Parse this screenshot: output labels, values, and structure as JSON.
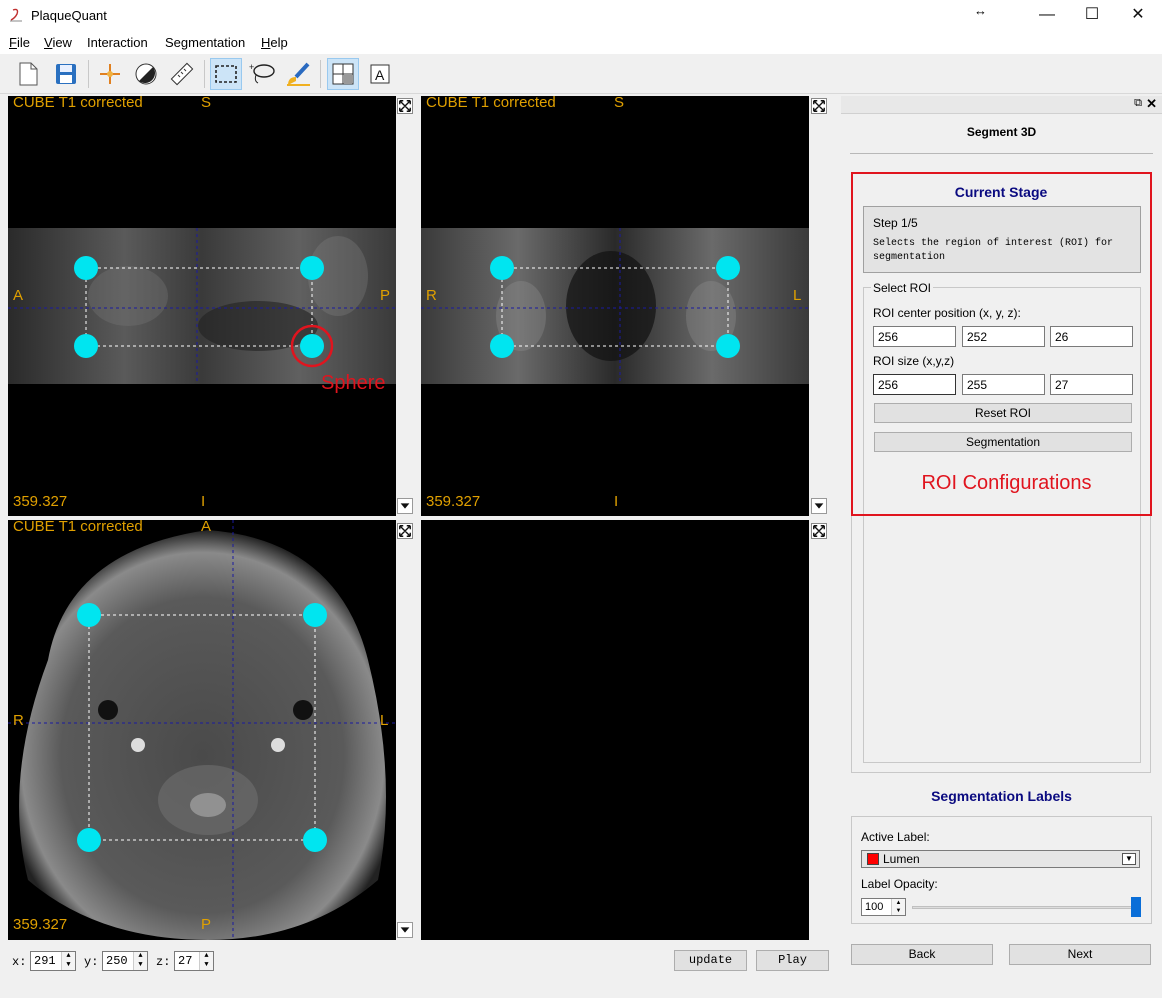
{
  "window": {
    "title": "PlaqueQuant",
    "controls": [
      "↔",
      "—",
      "☐",
      "✕"
    ]
  },
  "menu": [
    {
      "label": "File",
      "mnemonic": "F",
      "rest": "ile"
    },
    {
      "label": "View",
      "mnemonic": "V",
      "rest": "iew"
    },
    {
      "label": "Interaction",
      "mnemonic": "",
      "rest": "Interaction"
    },
    {
      "label": "Segmentation",
      "mnemonic": "",
      "rest": "Segmentation"
    },
    {
      "label": "Help",
      "mnemonic": "H",
      "rest": "elp"
    }
  ],
  "toolbar": {
    "icons": [
      "new-file-icon",
      "save-icon",
      "navigation-icon",
      "contrast-icon",
      "ruler-icon",
      "roi-rectangle-icon",
      "contour-icon",
      "brush-icon",
      "layout-icon",
      "annotation-icon"
    ],
    "active": [
      "roi-rectangle-icon",
      "layout-icon"
    ]
  },
  "viewports": {
    "sagittal": {
      "name": "CUBE T1 corrected",
      "top": "S",
      "bottom": "I",
      "left": "A",
      "right": "P",
      "value": "359.327"
    },
    "coronal": {
      "name": "CUBE T1 corrected",
      "top": "S",
      "bottom": "I",
      "left": "R",
      "right": "L",
      "value": "359.327"
    },
    "axial": {
      "name": "CUBE T1 corrected",
      "top": "A",
      "bottom": "P",
      "left": "R",
      "right": "L",
      "value": "359.327"
    }
  },
  "annotations": {
    "sphere": "Sphere",
    "roi_config": "ROI Configurations"
  },
  "bottom": {
    "x_label": "x:",
    "x_value": "291",
    "y_label": "y:",
    "y_value": "250",
    "z_label": "z:",
    "z_value": "27",
    "update_label": "update",
    "play_label": "Play"
  },
  "panel": {
    "title": "Segment 3D",
    "current_stage": {
      "heading": "Current Stage",
      "step": "Step 1/5",
      "description_line1": "Selects the region of interest (ROI) for",
      "description_line2": "segmentation"
    },
    "select_roi": {
      "title": "Select ROI",
      "center_label": "ROI center position (x, y, z):",
      "center": [
        "256",
        "252",
        "26"
      ],
      "size_label": "ROI size (x,y,z)",
      "size": [
        "256",
        "255",
        "27"
      ],
      "reset_label": "Reset ROI",
      "segmentation_label": "Segmentation"
    },
    "labels": {
      "heading": "Segmentation Labels",
      "active_label": "Active Label:",
      "active_value": "Lumen",
      "active_color": "#ff0000",
      "opacity_label": "Label Opacity:",
      "opacity_value": "100",
      "opacity_level": 1.0
    },
    "back_label": "Back",
    "next_label": "Next"
  },
  "colors": {
    "handle": "#00e5f0",
    "annotation_red": "#e0141e",
    "overlay_text": "#e0a000",
    "crosshair": "#1a1aa0"
  }
}
